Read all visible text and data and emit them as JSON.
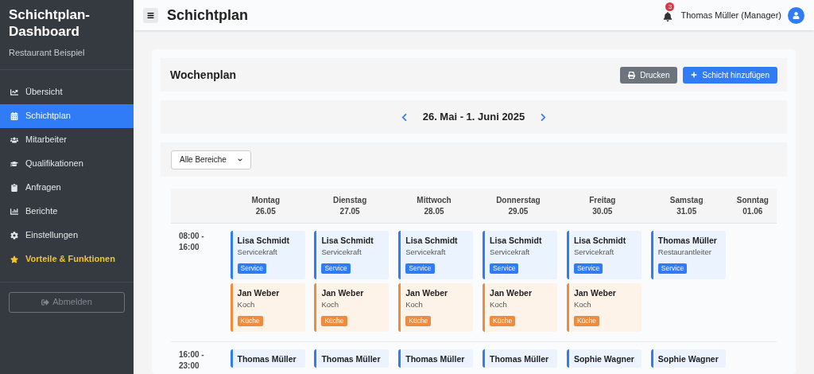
{
  "sidebar": {
    "title": "Schichtplan-Dashboard",
    "subtitle": "Restaurant Beispiel",
    "items": [
      {
        "label": "Übersicht",
        "kind": "link",
        "selected": false
      },
      {
        "label": "Schichtplan",
        "kind": "link",
        "selected": true
      },
      {
        "label": "Mitarbeiter",
        "kind": "link",
        "selected": false
      },
      {
        "label": "Qualifikationen",
        "kind": "link",
        "selected": false
      },
      {
        "label": "Anfragen",
        "kind": "link",
        "selected": false
      },
      {
        "label": "Berichte",
        "kind": "link",
        "selected": false
      },
      {
        "label": "Einstellungen",
        "kind": "link",
        "selected": false
      },
      {
        "label": "Vorteile & Funktionen",
        "kind": "feature",
        "selected": false
      }
    ],
    "logout_button": {
      "label": "Abmelden",
      "disabled": true
    }
  },
  "header": {
    "title": "Schichtplan",
    "notification_count": "3",
    "user": "Thomas Müller (Manager)"
  },
  "card": {
    "title": "Wochenplan",
    "buttons": [
      {
        "label": "Drucken",
        "kind": "secondary"
      },
      {
        "label": "Schicht hinzufügen",
        "kind": "primary"
      }
    ],
    "week": "26. Mai - 1. Juni 2025",
    "filter": {
      "value": "Alle Bereiche"
    }
  },
  "table": {
    "days": [
      {
        "name": "Montag",
        "date": "26.05"
      },
      {
        "name": "Dienstag",
        "date": "27.05"
      },
      {
        "name": "Mittwoch",
        "date": "28.05"
      },
      {
        "name": "Donnerstag",
        "date": "29.05"
      },
      {
        "name": "Freitag",
        "date": "30.05"
      },
      {
        "name": "Samstag",
        "date": "31.05"
      },
      {
        "name": "Sonntag",
        "date": "01.06"
      }
    ],
    "rows": [
      {
        "time": "08:00 - 16:00",
        "cells": [
          [
            {
              "name": "Lisa Schmidt",
              "role": "Servicekraft",
              "area": "Service",
              "kind": "service"
            },
            {
              "name": "Jan Weber",
              "role": "Koch",
              "area": "Küche",
              "kind": "kitchen"
            }
          ],
          [
            {
              "name": "Lisa Schmidt",
              "role": "Servicekraft",
              "area": "Service",
              "kind": "service"
            },
            {
              "name": "Jan Weber",
              "role": "Koch",
              "area": "Küche",
              "kind": "kitchen"
            }
          ],
          [
            {
              "name": "Lisa Schmidt",
              "role": "Servicekraft",
              "area": "Service",
              "kind": "service"
            },
            {
              "name": "Jan Weber",
              "role": "Koch",
              "area": "Küche",
              "kind": "kitchen"
            }
          ],
          [
            {
              "name": "Lisa Schmidt",
              "role": "Servicekraft",
              "area": "Service",
              "kind": "service"
            },
            {
              "name": "Jan Weber",
              "role": "Koch",
              "area": "Küche",
              "kind": "kitchen"
            }
          ],
          [
            {
              "name": "Lisa Schmidt",
              "role": "Servicekraft",
              "area": "Service",
              "kind": "service"
            },
            {
              "name": "Jan Weber",
              "role": "Koch",
              "area": "Küche",
              "kind": "kitchen"
            }
          ],
          [
            {
              "name": "Thomas Müller",
              "role": "Restaurantleiter",
              "area": "Service",
              "kind": "service"
            }
          ],
          []
        ]
      },
      {
        "time": "16:00 - 23:00",
        "cells": [
          [
            {
              "name": "Thomas Müller",
              "kind": "service"
            }
          ],
          [
            {
              "name": "Thomas Müller",
              "kind": "service"
            }
          ],
          [
            {
              "name": "Thomas Müller",
              "kind": "service"
            }
          ],
          [
            {
              "name": "Thomas Müller",
              "kind": "service"
            }
          ],
          [
            {
              "name": "Sophie Wagner",
              "kind": "service"
            }
          ],
          [
            {
              "name": "Sophie Wagner",
              "kind": "service"
            }
          ],
          []
        ]
      }
    ]
  }
}
